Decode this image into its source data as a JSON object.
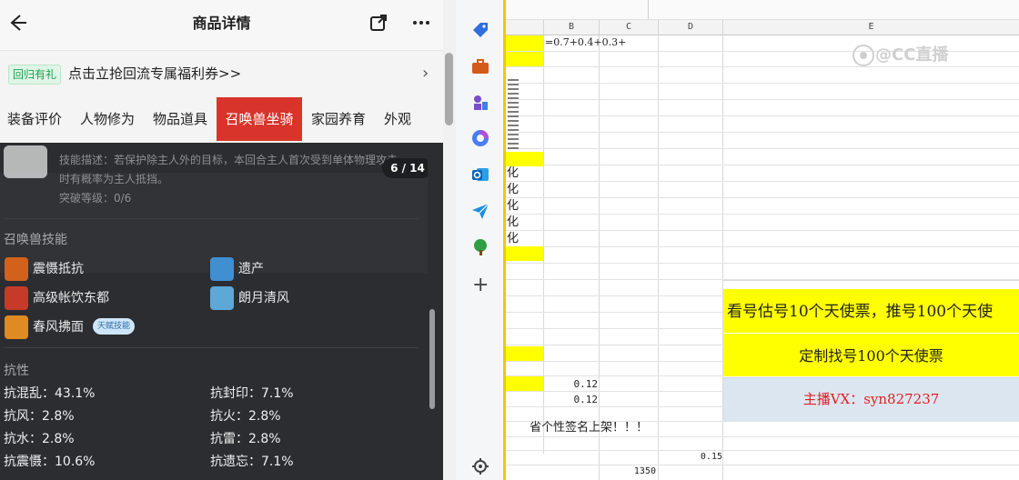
{
  "phone": {
    "title": "商品详情",
    "back_icon": "arrow-left-icon",
    "share_icon": "share-external-icon",
    "more_icon": "more-dots-icon",
    "banner": {
      "tag": "回归有礼",
      "text": "点击立抢回流专属福利券>>",
      "arrow": "›"
    },
    "tabs": [
      {
        "label": "装备评价"
      },
      {
        "label": "人物修为"
      },
      {
        "label": "物品道具"
      },
      {
        "label": "召唤兽坐骑",
        "active": true
      },
      {
        "label": "家园养育"
      },
      {
        "label": "外观"
      }
    ],
    "detail": {
      "skill_desc": "技能描述：若保护除主人外的目标，本回合主人首次受到单体物理攻击",
      "skill_desc2": "时有概率为主人抵挡。",
      "breakthrough": "突破等级：0/6",
      "pager": "6 / 14"
    },
    "skills_title": "召唤兽技能",
    "skills": [
      {
        "name": "震慑抵抗",
        "color": "#d2621b"
      },
      {
        "name": "遗产",
        "color": "#3f8fd1"
      },
      {
        "name": "高级帐饮东都",
        "color": "#c63a2a"
      },
      {
        "name": "朗月清风",
        "color": "#5ea8d8"
      },
      {
        "name": "春风拂面",
        "color": "#e08a22",
        "badge": "天赋技能"
      }
    ],
    "resist_title": "抗性",
    "resist": [
      [
        "抗混乱：43.1%",
        "抗封印：7.1%"
      ],
      [
        "抗风：2.8%",
        "抗火：2.8%"
      ],
      [
        "抗水：2.8%",
        "抗雷：2.8%"
      ],
      [
        "抗震慑：10.6%",
        "抗遗忘：7.1%"
      ]
    ]
  },
  "toolbar": {
    "icons": [
      "tag-icon",
      "toolbox-icon",
      "chess-icon",
      "copilot-icon",
      "outlook-icon",
      "send-icon",
      "tree-icon",
      "plus-icon",
      "settings-icon"
    ],
    "plus": "+"
  },
  "sheet": {
    "columns": [
      "B",
      "C",
      "D",
      "E"
    ],
    "formula": "=0.7+0.4+0.3+",
    "hua": [
      "化",
      "化",
      "化",
      "化",
      "化"
    ],
    "e_row1": "看号估号10个天使票，推号100个天使",
    "e_row2": "定制找号100个天使票",
    "e_row3": "主播VX：syn827237",
    "b_val1": "0.12",
    "b_val2": "0.12",
    "banner_row": "省个性签名上架！！！",
    "d_val": "0.15",
    "c_val": "1350",
    "watermark": "@CC直播",
    "colors": {
      "yellow": "#ffff00",
      "blue_cell": "#dce6f1",
      "red_text": "#e02020"
    }
  }
}
